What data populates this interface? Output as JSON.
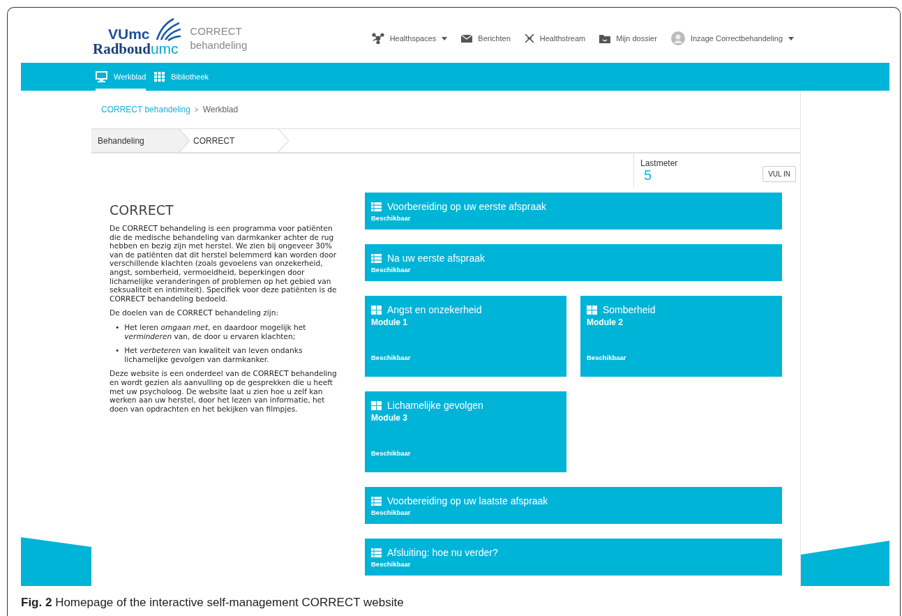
{
  "logo": {
    "line1": "VUmc",
    "line2_main": "Radboud",
    "line2_suffix": "umc"
  },
  "site_title": {
    "line1": "CORRECT",
    "line2": "behandeling"
  },
  "top_nav": [
    {
      "label": "Healthspaces",
      "dropdown": true
    },
    {
      "label": "Berichten",
      "dropdown": false
    },
    {
      "label": "Healthstream",
      "dropdown": false
    },
    {
      "label": "Mijn dossier",
      "dropdown": false
    },
    {
      "label": "Inzage Correctbehandeling",
      "dropdown": true
    }
  ],
  "tabs": [
    {
      "label": "Werkblad",
      "selected": true
    },
    {
      "label": "Bibliotheek",
      "selected": false
    }
  ],
  "breadcrumb": {
    "link": "CORRECT behandeling",
    "separator": ">",
    "current": "Werkblad"
  },
  "steps": [
    {
      "label": "Behandeling",
      "selected": false
    },
    {
      "label": "CORRECT",
      "selected": true
    }
  ],
  "intro": {
    "title": "CORRECT",
    "paragraph_1": "De CORRECT behandeling is een programma voor patiënten die de medische behandeling van darmkanker achter de rug hebben en bezig zijn met herstel. We zien bij ongeveer 30% van de patiënten dat dit herstel belemmerd kan worden door verschillende klachten (zoals gevoelens van onzekerheid, angst, somberheid, vermoeidheid, beperkingen door lichamelijke veranderingen of problemen op het gebied van seksualiteit en intimiteit). Specifiek voor deze patiënten is de CORRECT behandeling bedoeld.",
    "paragraph_2": "De doelen van de CORRECT behandeling zijn:",
    "goals": [
      {
        "bullet": "•",
        "text": "Het leren *omgaan met*, en daardoor mogelijk het *verminderen* van, de door u ervaren klachten;"
      },
      {
        "bullet": "•",
        "text": "Het *verbeteren* van kwaliteit van leven ondanks lichamelijke gevolgen van darmkanker."
      }
    ],
    "paragraph_3": "Deze website is een onderdeel van de CORRECT behandeling en wordt gezien als aanvulling op de gesprekken die u heeft met uw psycholoog. De website laat u zien hoe u zelf kan werken aan uw herstel, door het lezen van informatie, het doen van opdrachten en het bekijken van filmpjes."
  },
  "lastmeter": {
    "label": "Lastmeter",
    "value": "5",
    "button": "VUL IN"
  },
  "modules": [
    {
      "kind": "section",
      "title": "Voorbereiding op uw eerste afspraak",
      "status": "Beschikbaar"
    },
    {
      "kind": "section",
      "title": "Na uw eerste afspraak",
      "status": "Beschikbaar"
    },
    {
      "kind": "module",
      "title": "Angst en onzekerheid",
      "subtitle": "Module 1",
      "status": "Beschikbaar"
    },
    {
      "kind": "module",
      "title": "Somberheid",
      "subtitle": "Module 2",
      "status": "Beschikbaar"
    },
    {
      "kind": "module",
      "title": "Lichamelijke gevolgen",
      "subtitle": "Module 3",
      "status": "Beschikbaar"
    },
    {
      "kind": "section",
      "title": "Voorbereiding op uw laatste afspraak",
      "status": "Beschikbaar"
    },
    {
      "kind": "section",
      "title": "Afsluiting: hoe nu verder?",
      "status": "Beschikbaar"
    }
  ],
  "caption": "**Fig. 2** Homepage of the interactive self-management CORRECT website"
}
